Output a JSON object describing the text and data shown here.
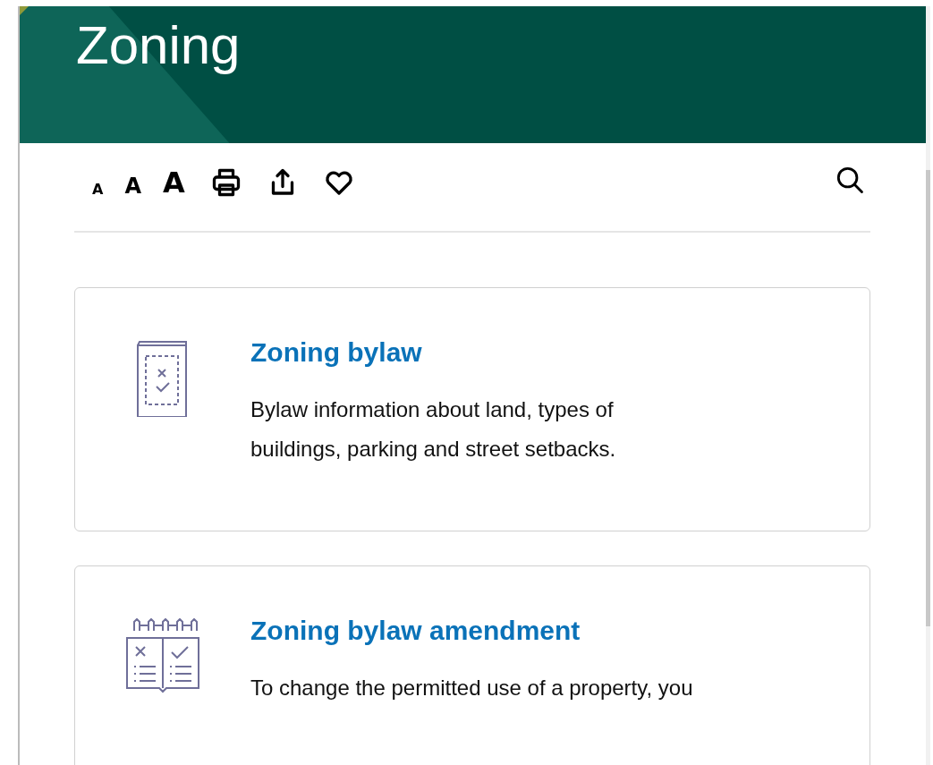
{
  "header": {
    "title": "Zoning"
  },
  "toolbar": {
    "font_sizes": [
      {
        "label": "A",
        "kind": "small"
      },
      {
        "label": "A",
        "kind": "medium"
      },
      {
        "label": "A",
        "kind": "large"
      }
    ]
  },
  "cards": [
    {
      "kind": "booklet",
      "title": "Zoning bylaw",
      "description": "Bylaw information about land, types of buildings, parking and street setbacks."
    },
    {
      "kind": "openbook",
      "title": "Zoning bylaw amendment",
      "description": "To change the permitted use of a property, you"
    }
  ]
}
